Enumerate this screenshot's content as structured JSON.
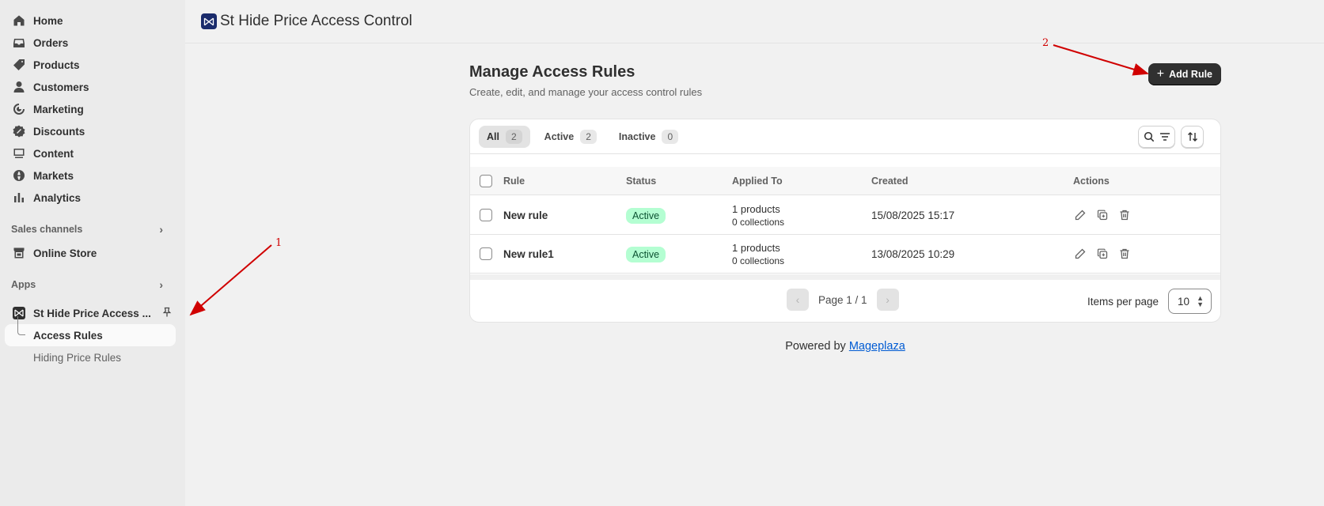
{
  "sidebar": {
    "items": [
      {
        "label": "Home",
        "icon": "home-icon"
      },
      {
        "label": "Orders",
        "icon": "orders-icon"
      },
      {
        "label": "Products",
        "icon": "tag-icon"
      },
      {
        "label": "Customers",
        "icon": "person-icon"
      },
      {
        "label": "Marketing",
        "icon": "target-icon"
      },
      {
        "label": "Discounts",
        "icon": "discount-icon"
      },
      {
        "label": "Content",
        "icon": "content-icon"
      },
      {
        "label": "Markets",
        "icon": "globe-icon"
      },
      {
        "label": "Analytics",
        "icon": "chart-icon"
      }
    ],
    "sales_channels": "Sales channels",
    "online_store": "Online Store",
    "apps": "Apps",
    "app_name": "St Hide Price Access ...",
    "sub_items": [
      "Access Rules",
      "Hiding Price Rules"
    ]
  },
  "header": {
    "title": "St Hide Price Access Control"
  },
  "page": {
    "title": "Manage Access Rules",
    "subtitle": "Create, edit, and manage your access control rules",
    "add_button": "Add Rule"
  },
  "tabs": [
    {
      "label": "All",
      "count": "2"
    },
    {
      "label": "Active",
      "count": "2"
    },
    {
      "label": "Inactive",
      "count": "0"
    }
  ],
  "table": {
    "columns": [
      "Rule",
      "Status",
      "Applied To",
      "Created",
      "Actions"
    ],
    "rows": [
      {
        "name": "New rule",
        "status": "Active",
        "products": "1 products",
        "collections": "0 collections",
        "created": "15/08/2025 15:17"
      },
      {
        "name": "New rule1",
        "status": "Active",
        "products": "1 products",
        "collections": "0 collections",
        "created": "13/08/2025 10:29"
      }
    ]
  },
  "pagination": {
    "page_text": "Page 1 / 1",
    "items_per_page_label": "Items per page",
    "items_per_page": "10"
  },
  "footer": {
    "powered_by": "Powered by",
    "link": "Mageplaza"
  },
  "annotations": {
    "one": "1",
    "two": "2"
  },
  "colors": {
    "accent_dark": "#303030",
    "badge_bg": "#b4fed2",
    "annotation": "#d00000",
    "link": "#005bd3"
  }
}
